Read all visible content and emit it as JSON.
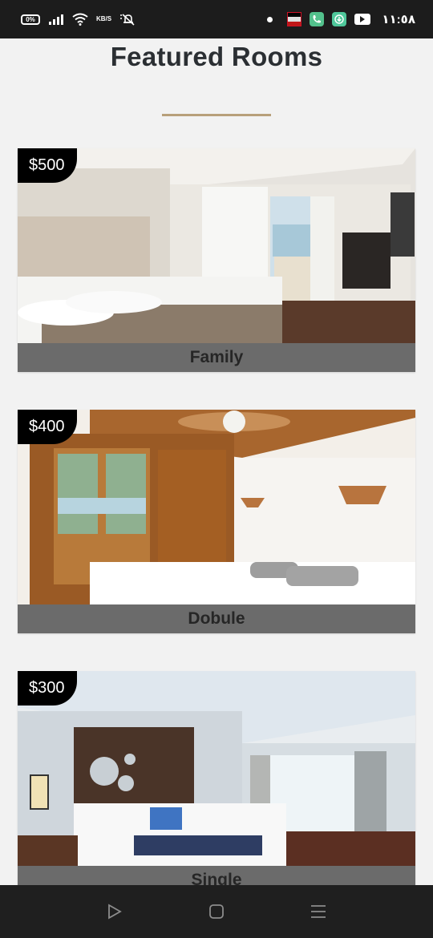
{
  "status_bar": {
    "battery_label": "0%",
    "net_speed": "KB/S",
    "time": "١١:٥٨",
    "icons": [
      "battery-icon",
      "signal-icon",
      "wifi-icon",
      "net-speed-icon",
      "bell-off-icon",
      "notification-dot-icon",
      "flag-icon",
      "phone-app-icon",
      "download-app-icon",
      "youtube-icon"
    ]
  },
  "page": {
    "title": "Featured Rooms"
  },
  "rooms": [
    {
      "price": "$500",
      "name": "Family"
    },
    {
      "price": "$400",
      "name": "Dobule"
    },
    {
      "price": "$300",
      "name": "Single"
    }
  ],
  "colors": {
    "accent_rule": "#b8a07a",
    "caption_bg": "#6b6b6b",
    "price_bg": "#000000",
    "status_bar": "#1c1c1c"
  },
  "nav_bar": {
    "icons": [
      "back-triangle-icon",
      "home-square-icon",
      "recents-menu-icon"
    ]
  }
}
